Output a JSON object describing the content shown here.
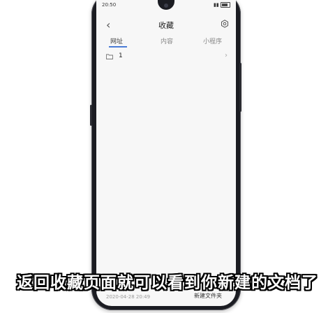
{
  "status_bar": {
    "time": "20:50"
  },
  "header": {
    "title": "收藏",
    "back_icon": "chevron-left-icon",
    "settings_icon": "gear-icon"
  },
  "tabs": [
    {
      "label": "网址",
      "active": true
    },
    {
      "label": "内容",
      "active": false
    },
    {
      "label": "小程序",
      "active": false
    }
  ],
  "list": [
    {
      "label": "1",
      "icon": "folder-icon"
    }
  ],
  "footer": {
    "date": "2020-04-28 20:49",
    "new_folder_label": "新建文件夹"
  },
  "caption": "返回收藏页面就可以看到你新建的文档了",
  "colors": {
    "accent": "#4a7bd6",
    "phone_body": "#1b1c22",
    "screen_bg": "#f7f7f7"
  }
}
